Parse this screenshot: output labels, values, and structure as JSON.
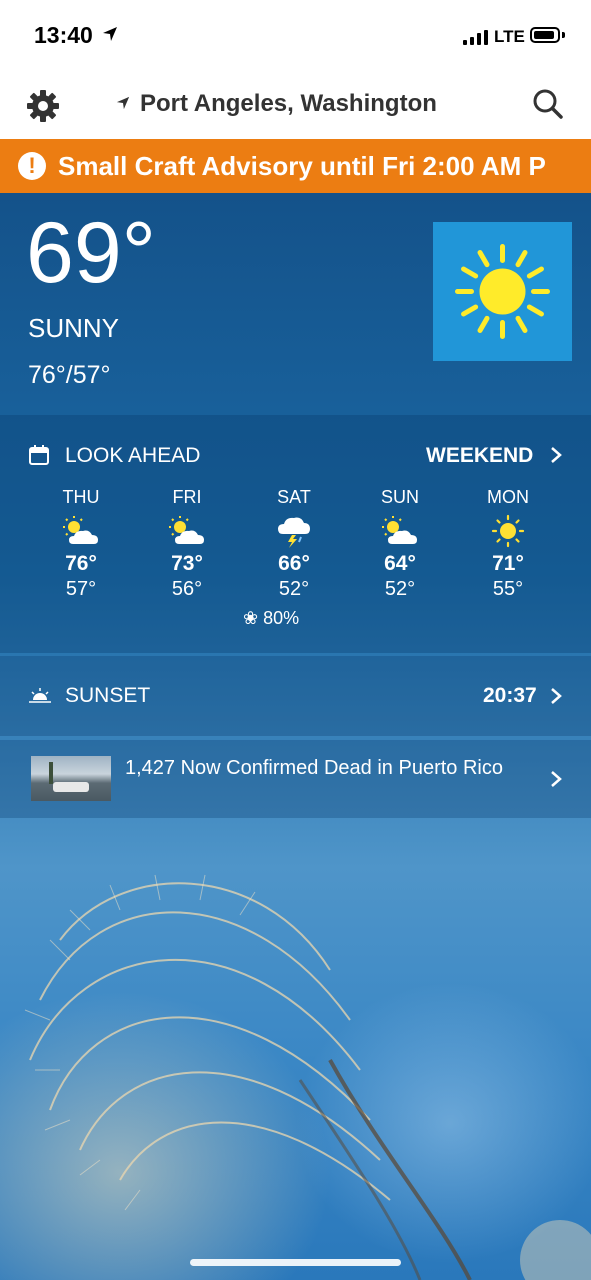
{
  "status_bar": {
    "time": "13:40",
    "network": "LTE",
    "icons": [
      "location-arrow-icon",
      "signal-icon",
      "battery-icon"
    ]
  },
  "header": {
    "location": "Port Angeles, Washington",
    "icons": [
      "gear-icon",
      "location-arrow-icon",
      "search-icon"
    ]
  },
  "advisory": {
    "text": "Small Craft Advisory until Fri 2:00 AM P",
    "icon": "alert-icon",
    "color": "#ec7d12"
  },
  "current": {
    "temperature": "69°",
    "condition": "SUNNY",
    "hi_lo": "76°/57°",
    "icon": "sun-icon"
  },
  "look_ahead": {
    "title": "LOOK AHEAD",
    "link": "WEEKEND",
    "days": [
      {
        "name": "THU",
        "hi": "76°",
        "lo": "57°",
        "icon": "partly-cloudy-icon"
      },
      {
        "name": "FRI",
        "hi": "73°",
        "lo": "56°",
        "icon": "partly-cloudy-icon"
      },
      {
        "name": "SAT",
        "hi": "66°",
        "lo": "52°",
        "icon": "thunderstorm-icon",
        "precip": "80%"
      },
      {
        "name": "SUN",
        "hi": "64°",
        "lo": "52°",
        "icon": "partly-cloudy-icon"
      },
      {
        "name": "MON",
        "hi": "71°",
        "lo": "55°",
        "icon": "sun-icon"
      }
    ]
  },
  "sunset": {
    "label": "SUNSET",
    "time": "20:37"
  },
  "news": {
    "headline": "1,427 Now Confirmed Dead in Puerto Rico"
  }
}
